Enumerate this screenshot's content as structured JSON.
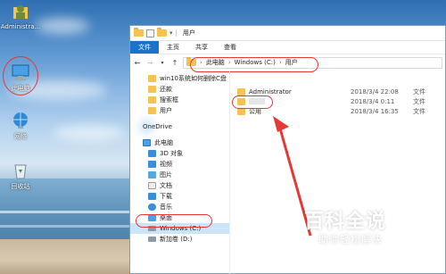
{
  "desktop": {
    "icons": [
      {
        "label": "Administra...",
        "icon": "user-folder-icon"
      },
      {
        "label": "此电脑",
        "icon": "this-pc-icon"
      },
      {
        "label": "网络",
        "icon": "network-icon"
      },
      {
        "label": "回收站",
        "icon": "recycle-bin-icon"
      }
    ]
  },
  "window": {
    "title": "用户",
    "ribbon_tabs": [
      "文件",
      "主页",
      "共享",
      "查看"
    ],
    "address": {
      "parts": [
        "此电脑",
        "Windows (C:)",
        "用户"
      ]
    }
  },
  "nav_pane": {
    "quick_access": [
      "win10系统如何删除C盘",
      "还款",
      "搜索框",
      "用户"
    ],
    "onedrive": "OneDrive",
    "this_pc": "此电脑",
    "pc_items": [
      "3D 对象",
      "视频",
      "图片",
      "文档",
      "下载",
      "音乐",
      "桌面",
      "Windows (C:)",
      "新加卷 (D:)"
    ]
  },
  "files": [
    {
      "name": "Administrator",
      "date": "2018/3/4 22:08",
      "type": "文件"
    },
    {
      "name": "",
      "date": "2018/3/4 0:11",
      "type": "文件"
    },
    {
      "name": "公用",
      "date": "2018/3/4 16:35",
      "type": "文件"
    }
  ],
  "watermark": {
    "main": "百科全说",
    "sub": "助你轻松解决"
  },
  "colors": {
    "accent": "#1a73c8",
    "annotation": "#e53935",
    "folder": "#f3c453"
  }
}
